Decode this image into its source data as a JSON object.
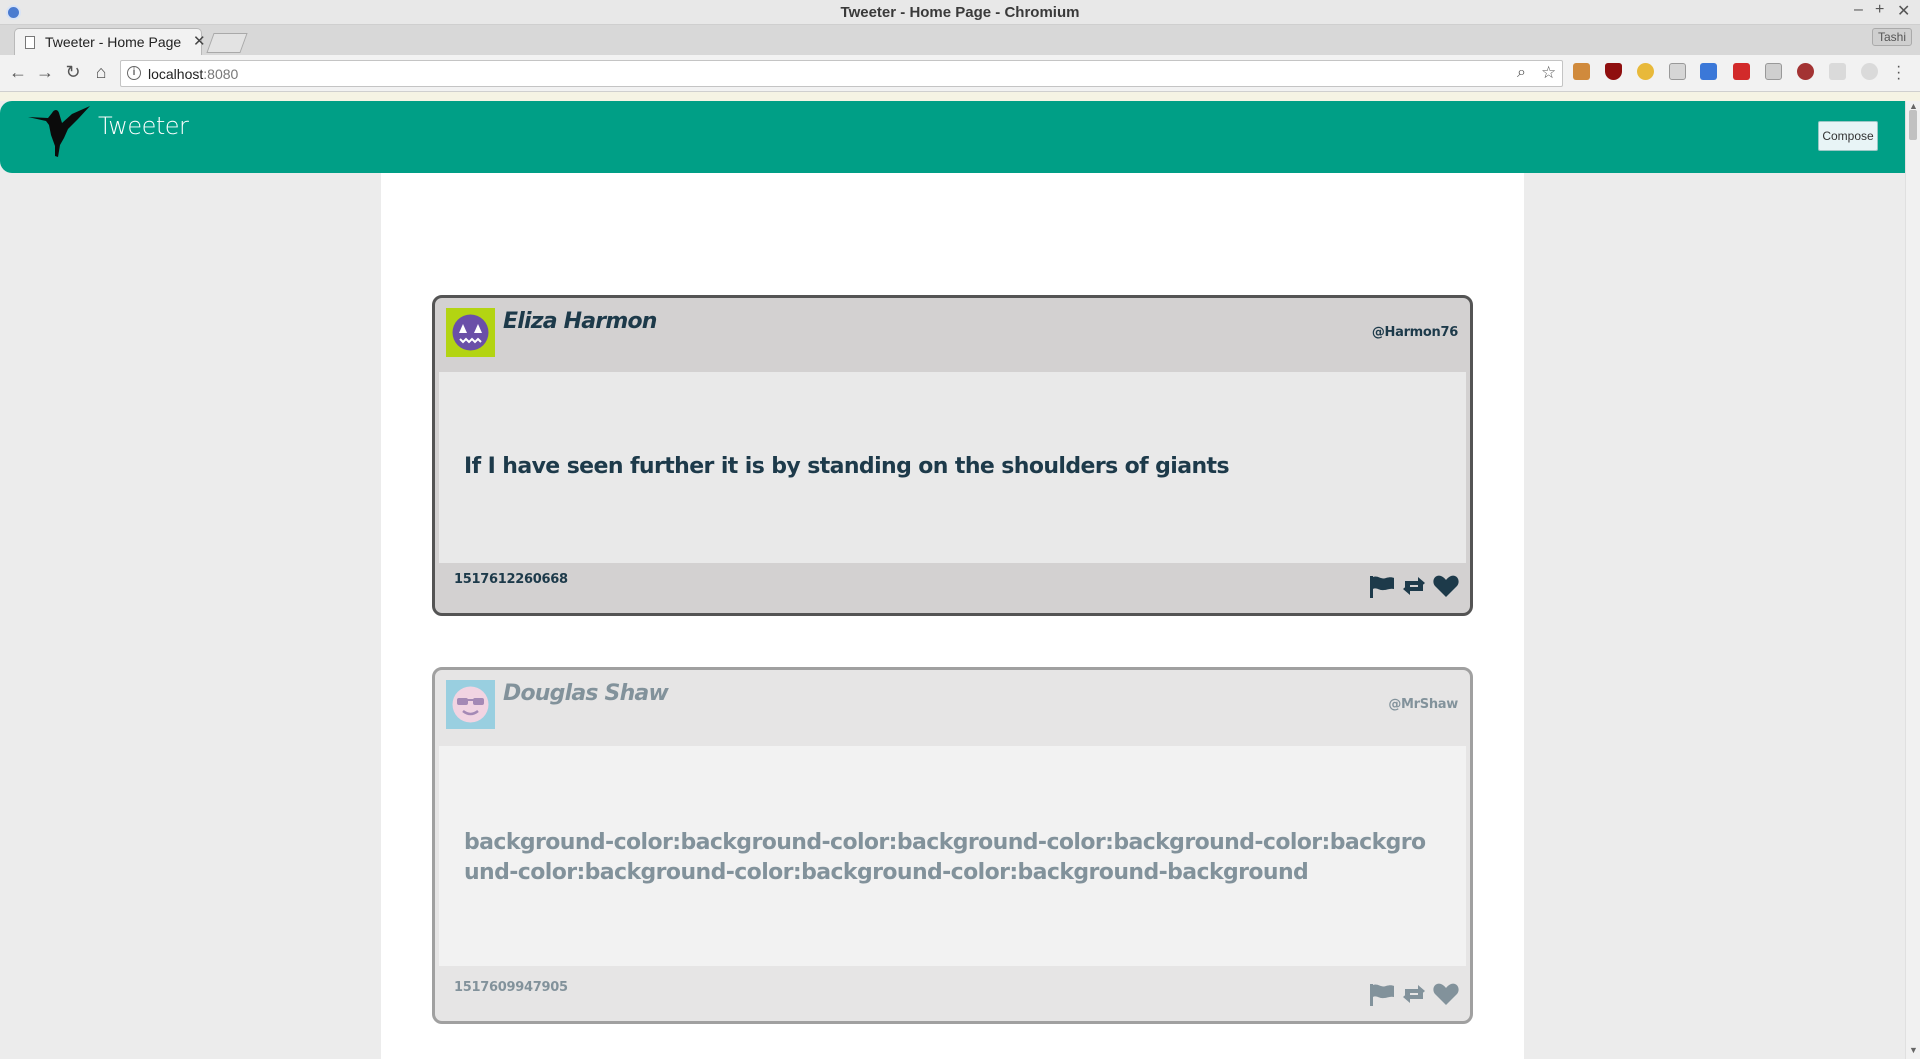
{
  "window": {
    "title": "Tweeter - Home Page - Chromium"
  },
  "tabs": [
    {
      "label": "Tweeter - Home Page"
    }
  ],
  "profile": {
    "name": "Tashi"
  },
  "address_bar": {
    "host": "localhost",
    "port": ":8080"
  },
  "navbar": {
    "brand": "Tweeter",
    "compose_label": "Compose",
    "color": "#009f86"
  },
  "tweets": [
    {
      "name": "Eliza Harmon",
      "handle": "@Harmon76",
      "text": "If I have seen further it is by standing on the shoulders of giants",
      "timestamp": "1517612260668",
      "avatar_icon": "purple-monster-avatar-icon",
      "avatar_bg": "#b3d412",
      "faded": false
    },
    {
      "name": "Douglas Shaw",
      "handle": "@MrShaw",
      "text": "background-color:background-color:background-color:background-color:background-color:background-color:background-color:background-background",
      "timestamp": "1517609947905",
      "avatar_icon": "sunglasses-face-avatar-icon",
      "avatar_bg": "#47a9c8",
      "faded": true
    }
  ],
  "actions": [
    "flag-icon",
    "retweet-icon",
    "heart-icon"
  ]
}
